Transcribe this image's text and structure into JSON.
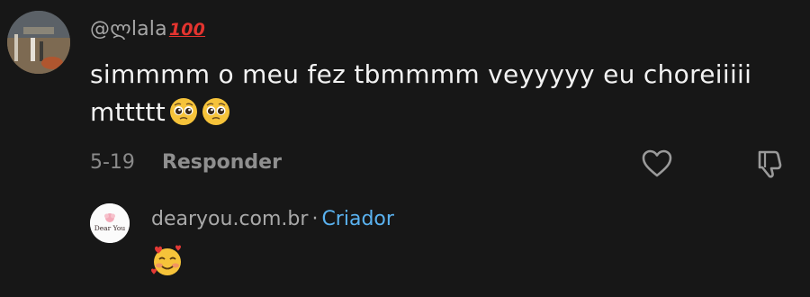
{
  "comment": {
    "username": "@ლlala",
    "username_badge": "100",
    "text": "simmmm o meu fez tbmmmm veyyyyy eu choreiiiii mttttt",
    "emojis": [
      "pleading-face",
      "pleading-face"
    ],
    "date": "5-19",
    "reply_label": "Responder"
  },
  "reply": {
    "avatar_text": "Dear You",
    "author": "dearyou.com.br",
    "separator": "·",
    "role": "Criador",
    "emoji": "smiling-face-with-hearts"
  },
  "colors": {
    "background": "#171717",
    "creator_accent": "#5ab2f0",
    "badge_red": "#e3342f",
    "emoji_yellow": "#f6c33a"
  }
}
